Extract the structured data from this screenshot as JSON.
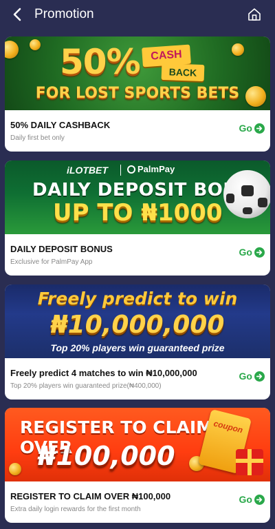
{
  "header": {
    "title": "Promotion",
    "back_icon": "chevron-left-icon",
    "home_icon": "home-icon"
  },
  "colors": {
    "background": "#2a2d52",
    "go": "#2aa84a"
  },
  "promotions": [
    {
      "banner": {
        "big": "50%",
        "tag1": "CASH",
        "tag2": "BACK",
        "line2": "FOR LOST SPORTS BETS"
      },
      "title": "50% DAILY CASHBACK",
      "subtitle": "Daily first bet only",
      "go": "Go"
    },
    {
      "banner": {
        "brand": "iLOTBET",
        "partner": "PalmPay",
        "line1": "DAILY DEPOSIT BONUS",
        "line2": "UP TO ₦1000"
      },
      "title": "DAILY DEPOSIT BONUS",
      "subtitle": "Exclusive for PalmPay App",
      "go": "Go"
    },
    {
      "banner": {
        "line1": "Freely predict to win",
        "line2": "₦10,000,000",
        "line3": "Top 20% players win guaranteed prize"
      },
      "title": "Freely predict 4 matches to win ₦10,000,000",
      "subtitle": "Top 20% players win guaranteed prize(₦400,000)",
      "go": "Go"
    },
    {
      "banner": {
        "line1": "REGISTER TO CLAIM OVER",
        "line2": "₦100,000",
        "coupon": "coupon"
      },
      "title": "REGISTER TO CLAIM OVER ₦100,000",
      "subtitle": "Extra daily login rewards for the first month",
      "go": "Go"
    }
  ]
}
